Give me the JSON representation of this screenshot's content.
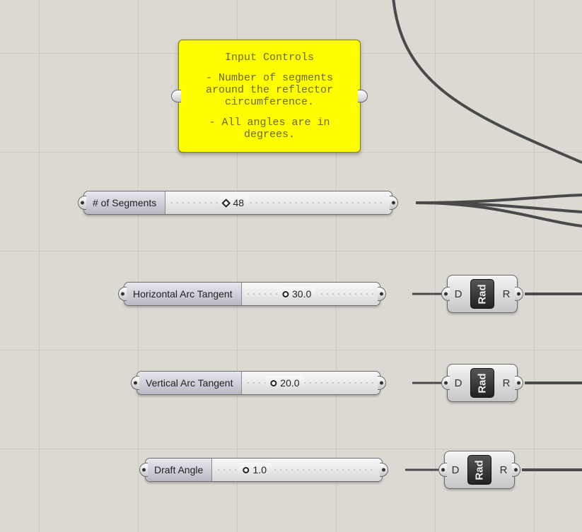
{
  "panel": {
    "title": "Input Controls",
    "line1": "- Number of segments around the reflector circumference.",
    "line2": "- All angles are in degrees."
  },
  "sliders": {
    "segments": {
      "label": "# of Segments",
      "value": "48",
      "marker": "diamond",
      "pos_pct": 30
    },
    "horiz": {
      "label": "Horizontal Arc Tangent",
      "value": "30.0",
      "marker": "circle",
      "pos_pct": 40
    },
    "vert": {
      "label": "Vertical Arc Tangent",
      "value": "20.0",
      "marker": "circle",
      "pos_pct": 31
    },
    "draft": {
      "label": "Draft Angle",
      "value": "1.0",
      "marker": "circle",
      "pos_pct": 25
    }
  },
  "rad": {
    "name": "Rad",
    "in": "D",
    "out": "R"
  }
}
